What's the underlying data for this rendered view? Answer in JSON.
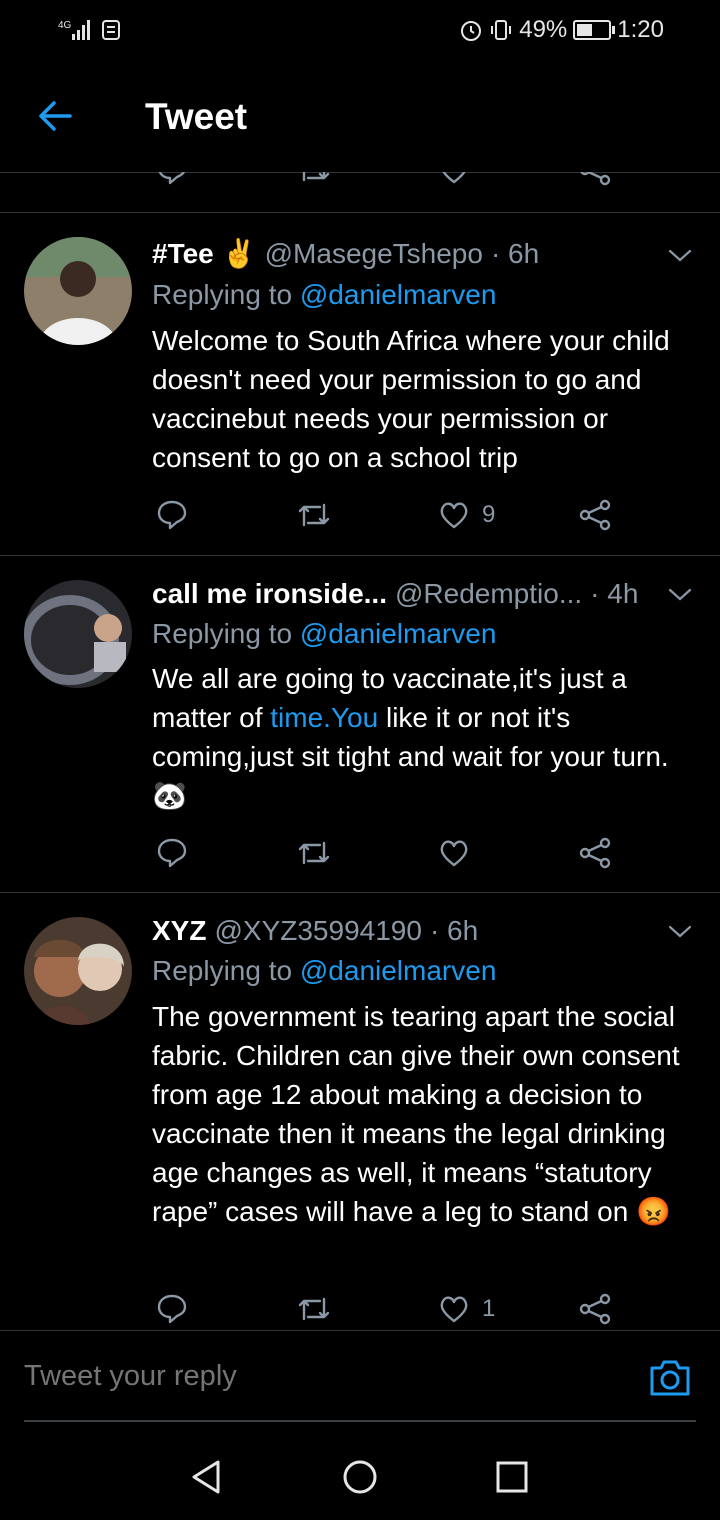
{
  "status_bar": {
    "network": "4G",
    "battery_percent": "49%",
    "battery_level": 0.49,
    "time": "1:20"
  },
  "header": {
    "title": "Tweet"
  },
  "tweets": [
    {
      "name": "#Tee",
      "name_emoji": "✌",
      "handle": "@MasegeTshepo",
      "time": "· 6h",
      "replying_label": "Replying to",
      "replying_to": "@danielmarven",
      "text": "Welcome to South Africa where your child doesn't need your permission to go and vaccinebut needs your permission or consent to go on a school trip",
      "likes": "9",
      "avatar_colors": [
        "#8d7f6a",
        "#f0f0f0"
      ]
    },
    {
      "name": "call me ironside...",
      "handle": "@Redemptio...",
      "time": "· 4h",
      "replying_label": "Replying to",
      "replying_to": "@danielmarven",
      "text_before": "We all are going to vaccinate,it's just a matter of ",
      "text_link": "time.You",
      "text_after": " like it or not it's coming,just sit tight and wait for your turn.",
      "text_emoji": "🐼",
      "likes": "",
      "avatar_colors": [
        "#6f7380",
        "#2a2a2e"
      ]
    },
    {
      "name": "XYZ",
      "handle": "@XYZ35994190",
      "time": "· 6h",
      "replying_label": "Replying to",
      "replying_to": "@danielmarven",
      "text": "The government is tearing apart the social fabric. Children can give their own consent from age 12 about making a decision to vaccinate then it means the legal drinking age changes as well, it means “statutory rape” cases will have a leg to stand on",
      "text_emoji": "😡",
      "likes": "1",
      "avatar_colors": [
        "#a06b4c",
        "#d8d2c4"
      ]
    }
  ],
  "reply_bar": {
    "placeholder": "Tweet your reply"
  },
  "colors": {
    "accent": "#1d9bf0",
    "muted": "#8b98a5",
    "divider": "#2f3336",
    "background": "#000000"
  },
  "icons": {
    "back": "arrow-left-icon",
    "reply": "reply-icon",
    "retweet": "retweet-icon",
    "like": "heart-icon",
    "share": "share-icon",
    "more": "chevron-down-icon",
    "camera": "camera-icon",
    "nav_back": "nav-back-icon",
    "nav_home": "nav-home-icon",
    "nav_recents": "nav-recents-icon"
  }
}
